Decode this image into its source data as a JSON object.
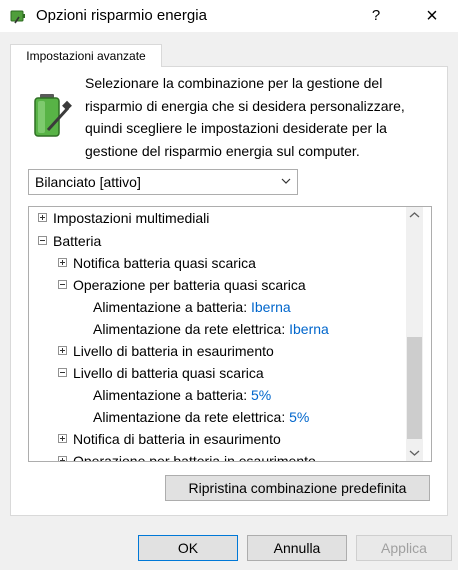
{
  "window": {
    "title": "Opzioni risparmio energia",
    "help_label": "?",
    "close_label": "×"
  },
  "tab": {
    "label": "Impostazioni avanzate"
  },
  "description": "Selezionare la combinazione per la gestione del risparmio di energia che si desidera personalizzare, quindi scegliere le impostazioni desiderate per la gestione del risparmio energia sul computer.",
  "plan_select": {
    "value": "Bilanciato [attivo]"
  },
  "tree": [
    {
      "label": "Impostazioni multimediali",
      "expander": "plus"
    },
    {
      "label": "Batteria",
      "expander": "minus"
    },
    {
      "label": "Notifica batteria quasi scarica",
      "expander": "plus"
    },
    {
      "label": "Operazione per batteria quasi scarica",
      "expander": "minus"
    },
    {
      "label": "Alimentazione a batteria:",
      "value": "Iberna"
    },
    {
      "label": "Alimentazione da rete elettrica:",
      "value": "Iberna"
    },
    {
      "label": "Livello di batteria in esaurimento",
      "expander": "plus"
    },
    {
      "label": "Livello di batteria quasi scarica",
      "expander": "minus"
    },
    {
      "label": "Alimentazione a batteria:",
      "value": "5%"
    },
    {
      "label": "Alimentazione da rete elettrica:",
      "value": "5%"
    },
    {
      "label": "Notifica di batteria in esaurimento",
      "expander": "plus"
    },
    {
      "label": "Operazione per batteria in esaurimento",
      "expander": "plus"
    }
  ],
  "buttons": {
    "reset": "Ripristina combinazione predefinita",
    "ok": "OK",
    "cancel": "Annulla",
    "apply": "Applica"
  },
  "colors": {
    "value_link": "#0066cc",
    "focus_border": "#0078d7"
  },
  "icons": {
    "app": "battery-plug-icon",
    "panel": "battery-icon",
    "combo": "chevron-down-icon"
  }
}
